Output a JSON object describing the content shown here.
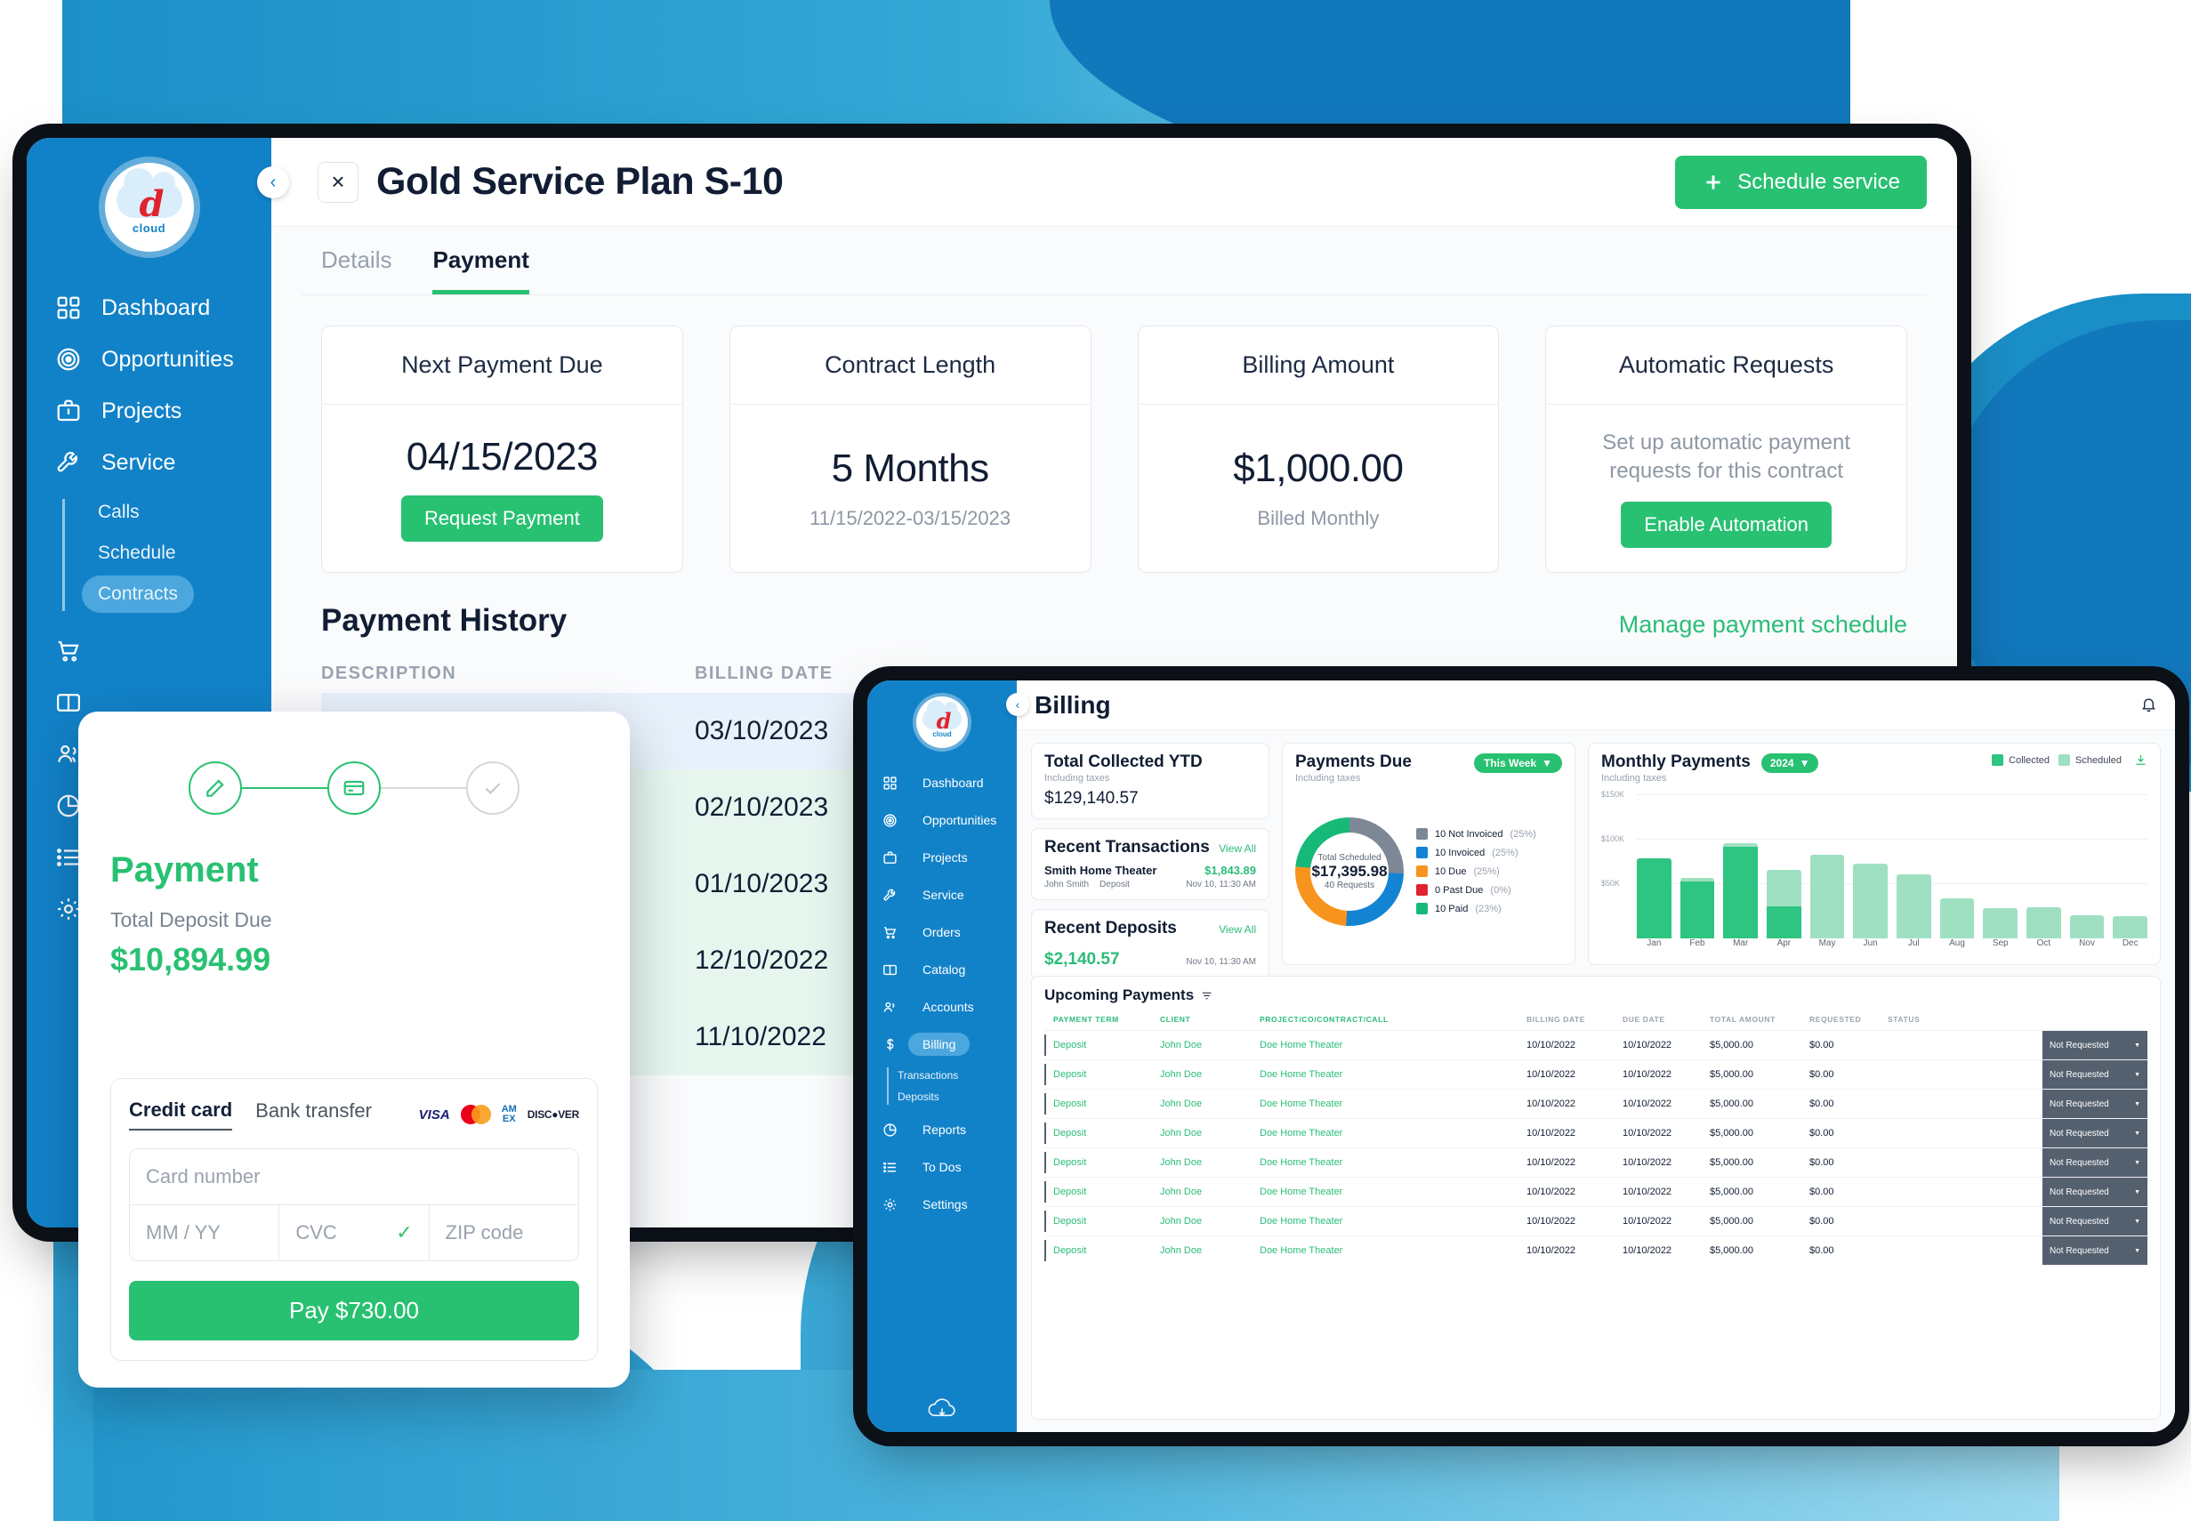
{
  "contract_window": {
    "title": "Gold Service Plan S-10",
    "close_label": "×",
    "collapse_label": "‹",
    "schedule_button": "Schedule service",
    "tabs": [
      {
        "label": "Details",
        "active": false
      },
      {
        "label": "Payment",
        "active": true
      }
    ],
    "sidebar": {
      "logo_text": "cloud",
      "logo_mark": "d",
      "items": [
        {
          "label": "Dashboard",
          "icon": "grid-icon"
        },
        {
          "label": "Opportunities",
          "icon": "target-icon"
        },
        {
          "label": "Projects",
          "icon": "briefcase-icon"
        },
        {
          "label": "Service",
          "icon": "wrench-icon"
        }
      ],
      "sub_items": [
        {
          "label": "Calls",
          "active": false
        },
        {
          "label": "Schedule",
          "active": false
        },
        {
          "label": "Contracts",
          "active": true
        }
      ],
      "icon_items": [
        {
          "icon": "cart-icon"
        },
        {
          "icon": "book-icon"
        },
        {
          "icon": "people-icon"
        },
        {
          "icon": "pie-icon"
        },
        {
          "icon": "list-icon"
        },
        {
          "icon": "gear-icon"
        }
      ]
    },
    "kpis": [
      {
        "title": "Next Payment Due",
        "value": "04/15/2023",
        "sub": "",
        "button": "Request Payment",
        "desc": ""
      },
      {
        "title": "Contract Length",
        "value": "5 Months",
        "sub": "11/15/2022-03/15/2023",
        "button": "",
        "desc": ""
      },
      {
        "title": "Billing Amount",
        "value": "$1,000.00",
        "sub": "Billed Monthly",
        "button": "",
        "desc": ""
      },
      {
        "title": "Automatic Requests",
        "value": "",
        "sub": "",
        "button": "Enable Automation",
        "desc": "Set up automatic payment requests for this contract"
      }
    ],
    "history": {
      "heading": "Payment History",
      "manage_link": "Manage payment schedule",
      "columns": [
        "DESCRIPTION",
        "BILLING DATE"
      ],
      "rows": [
        {
          "description": "",
          "billing_date": "03/10/2023",
          "tone": "blue"
        },
        {
          "description": "",
          "billing_date": "02/10/2023",
          "tone": "mint"
        },
        {
          "description": "",
          "billing_date": "01/10/2023",
          "tone": "mint"
        },
        {
          "description": "",
          "billing_date": "12/10/2022",
          "tone": "mint"
        },
        {
          "description": "",
          "billing_date": "11/10/2022",
          "tone": "mint"
        }
      ]
    }
  },
  "payment_modal": {
    "steps": [
      {
        "icon": "pencil-icon",
        "state": "done"
      },
      {
        "icon": "card-icon",
        "state": "current"
      },
      {
        "icon": "check-icon",
        "state": "pending"
      }
    ],
    "title": "Payment",
    "deposit_label": "Total Deposit Due",
    "deposit_amount": "$10,894.99",
    "method_tabs": [
      {
        "label": "Credit card",
        "active": true
      },
      {
        "label": "Bank transfer",
        "active": false
      }
    ],
    "brands": [
      "VISA",
      "Mastercard",
      "AMEX",
      "DISCOVER"
    ],
    "amex_line1": "AM",
    "amex_line2": "EX",
    "discover_label": "DISC●VER",
    "visa_label": "VISA",
    "fields": {
      "card_number_placeholder": "Card number",
      "expiry_placeholder": "MM / YY",
      "cvc_placeholder": "CVC",
      "zip_placeholder": "ZIP code",
      "cvc_valid_icon": "✓"
    },
    "pay_button": "Pay $730.00"
  },
  "billing_window": {
    "title": "Billing",
    "collapse_label": "‹",
    "bell_icon": "bell-icon",
    "sidebar": {
      "logo_text": "cloud",
      "logo_mark": "d",
      "items": [
        {
          "label": "Dashboard",
          "icon": "grid-icon",
          "active": false
        },
        {
          "label": "Opportunities",
          "icon": "target-icon",
          "active": false
        },
        {
          "label": "Projects",
          "icon": "briefcase-icon",
          "active": false
        },
        {
          "label": "Service",
          "icon": "wrench-icon",
          "active": false
        },
        {
          "label": "Orders",
          "icon": "cart-icon",
          "active": false
        },
        {
          "label": "Catalog",
          "icon": "book-icon",
          "active": false
        },
        {
          "label": "Accounts",
          "icon": "people-icon",
          "active": false
        },
        {
          "label": "Billing",
          "icon": "dollar-icon",
          "active": true
        }
      ],
      "sub_items": [
        {
          "label": "Transactions"
        },
        {
          "label": "Deposits"
        }
      ],
      "items_after": [
        {
          "label": "Reports",
          "icon": "pie-icon"
        },
        {
          "label": "To Dos",
          "icon": "list-icon"
        },
        {
          "label": "Settings",
          "icon": "gear-icon"
        }
      ]
    },
    "total_collected": {
      "title": "Total Collected YTD",
      "subtitle": "Including taxes",
      "value": "$129,140.57"
    },
    "recent_transactions": {
      "title": "Recent Transactions",
      "view_all": "View All",
      "name": "Smith Home Theater",
      "amount": "$1,843.89",
      "client": "John Smith",
      "type": "Deposit",
      "timestamp": "Nov 10, 11:30 AM"
    },
    "recent_deposits": {
      "title": "Recent Deposits",
      "view_all": "View All",
      "amount": "$2,140.57",
      "timestamp": "Nov 10, 11:30 AM"
    },
    "payments_due": {
      "title": "Payments Due",
      "subtitle": "Including taxes",
      "range_chip": "This Week",
      "center_label": "Total Scheduled",
      "center_value": "$17,395.98",
      "center_requests": "40 Requests"
    },
    "monthly_payments": {
      "title": "Monthly Payments",
      "subtitle": "Including taxes",
      "year_chip": "2024",
      "legend": [
        "Collected",
        "Scheduled"
      ],
      "download_icon": "download-icon"
    },
    "upcoming": {
      "title": "Upcoming Payments",
      "filter_icon": "filter-icon",
      "columns": [
        "PAYMENT TERM",
        "CLIENT",
        "PROJECT/CO/CONTRACT/CALL",
        "BILLING DATE",
        "DUE DATE",
        "TOTAL AMOUNT",
        "REQUESTED",
        "STATUS"
      ],
      "rows": [
        {
          "term": "Deposit",
          "client": "John Doe",
          "project": "Doe Home Theater",
          "billing_date": "10/10/2022",
          "due_date": "10/10/2022",
          "total": "$5,000.00",
          "requested": "$0.00",
          "status": "Not Requested"
        },
        {
          "term": "Deposit",
          "client": "John Doe",
          "project": "Doe Home Theater",
          "billing_date": "10/10/2022",
          "due_date": "10/10/2022",
          "total": "$5,000.00",
          "requested": "$0.00",
          "status": "Not Requested"
        },
        {
          "term": "Deposit",
          "client": "John Doe",
          "project": "Doe Home Theater",
          "billing_date": "10/10/2022",
          "due_date": "10/10/2022",
          "total": "$5,000.00",
          "requested": "$0.00",
          "status": "Not Requested"
        },
        {
          "term": "Deposit",
          "client": "John Doe",
          "project": "Doe Home Theater",
          "billing_date": "10/10/2022",
          "due_date": "10/10/2022",
          "total": "$5,000.00",
          "requested": "$0.00",
          "status": "Not Requested"
        },
        {
          "term": "Deposit",
          "client": "John Doe",
          "project": "Doe Home Theater",
          "billing_date": "10/10/2022",
          "due_date": "10/10/2022",
          "total": "$5,000.00",
          "requested": "$0.00",
          "status": "Not Requested"
        },
        {
          "term": "Deposit",
          "client": "John Doe",
          "project": "Doe Home Theater",
          "billing_date": "10/10/2022",
          "due_date": "10/10/2022",
          "total": "$5,000.00",
          "requested": "$0.00",
          "status": "Not Requested"
        },
        {
          "term": "Deposit",
          "client": "John Doe",
          "project": "Doe Home Theater",
          "billing_date": "10/10/2022",
          "due_date": "10/10/2022",
          "total": "$5,000.00",
          "requested": "$0.00",
          "status": "Not Requested"
        },
        {
          "term": "Deposit",
          "client": "John Doe",
          "project": "Doe Home Theater",
          "billing_date": "10/10/2022",
          "due_date": "10/10/2022",
          "total": "$5,000.00",
          "requested": "$0.00",
          "status": "Not Requested"
        }
      ]
    }
  },
  "colors": {
    "brand_blue": "#1282c8",
    "accent_green": "#28c172",
    "link_green": "#2bbd78",
    "dark_text": "#111d33",
    "muted_text": "#98a1ae",
    "status_grey": "#55606f",
    "donut_not_invoiced": "#7d8896",
    "donut_invoiced": "#1383d4",
    "donut_due": "#f7941e",
    "donut_past_due": "#e0232e",
    "donut_paid": "#17b978",
    "bar_collected": "#2ec481",
    "bar_scheduled": "#9fe0c2"
  },
  "chart_data": [
    {
      "type": "bar",
      "title": "Monthly Payments",
      "subtitle": "Including taxes",
      "xlabel": "",
      "ylabel": "",
      "ylim": [
        0,
        150000
      ],
      "ytick_labels": [
        "$50K",
        "$100K",
        "$150K"
      ],
      "ytick_values": [
        50000,
        100000,
        150000
      ],
      "grid": true,
      "legend": [
        "Collected",
        "Scheduled"
      ],
      "legend_position": "top-right",
      "categories": [
        "Jan",
        "Feb",
        "Mar",
        "Apr",
        "May",
        "Jun",
        "Jul",
        "Aug",
        "Sep",
        "Oct",
        "Nov",
        "Dec"
      ],
      "series": [
        {
          "name": "Collected",
          "values": [
            99000,
            71000,
            113000,
            40000,
            0,
            0,
            0,
            0,
            0,
            0,
            0,
            0
          ]
        },
        {
          "name": "Scheduled",
          "values": [
            0,
            4000,
            5000,
            45000,
            104000,
            92000,
            79000,
            50000,
            38000,
            39000,
            29000,
            28000
          ]
        }
      ]
    },
    {
      "type": "pie",
      "title": "Payments Due",
      "subtitle": "Including taxes",
      "center_label": "Total Scheduled",
      "center_value": "$17,395.98",
      "center_note": "40 Requests",
      "labels": [
        "10 Not Invoiced",
        "10 Invoiced",
        "10 Due",
        "0 Past Due",
        "10 Paid"
      ],
      "values": [
        25,
        25,
        25,
        0,
        23
      ],
      "percent_labels": [
        "(25%)",
        "(25%)",
        "(25%)",
        "(0%)",
        "(23%)"
      ],
      "colors": [
        "#7d8896",
        "#1383d4",
        "#f7941e",
        "#e0232e",
        "#17b978"
      ],
      "legend_position": "right"
    }
  ]
}
